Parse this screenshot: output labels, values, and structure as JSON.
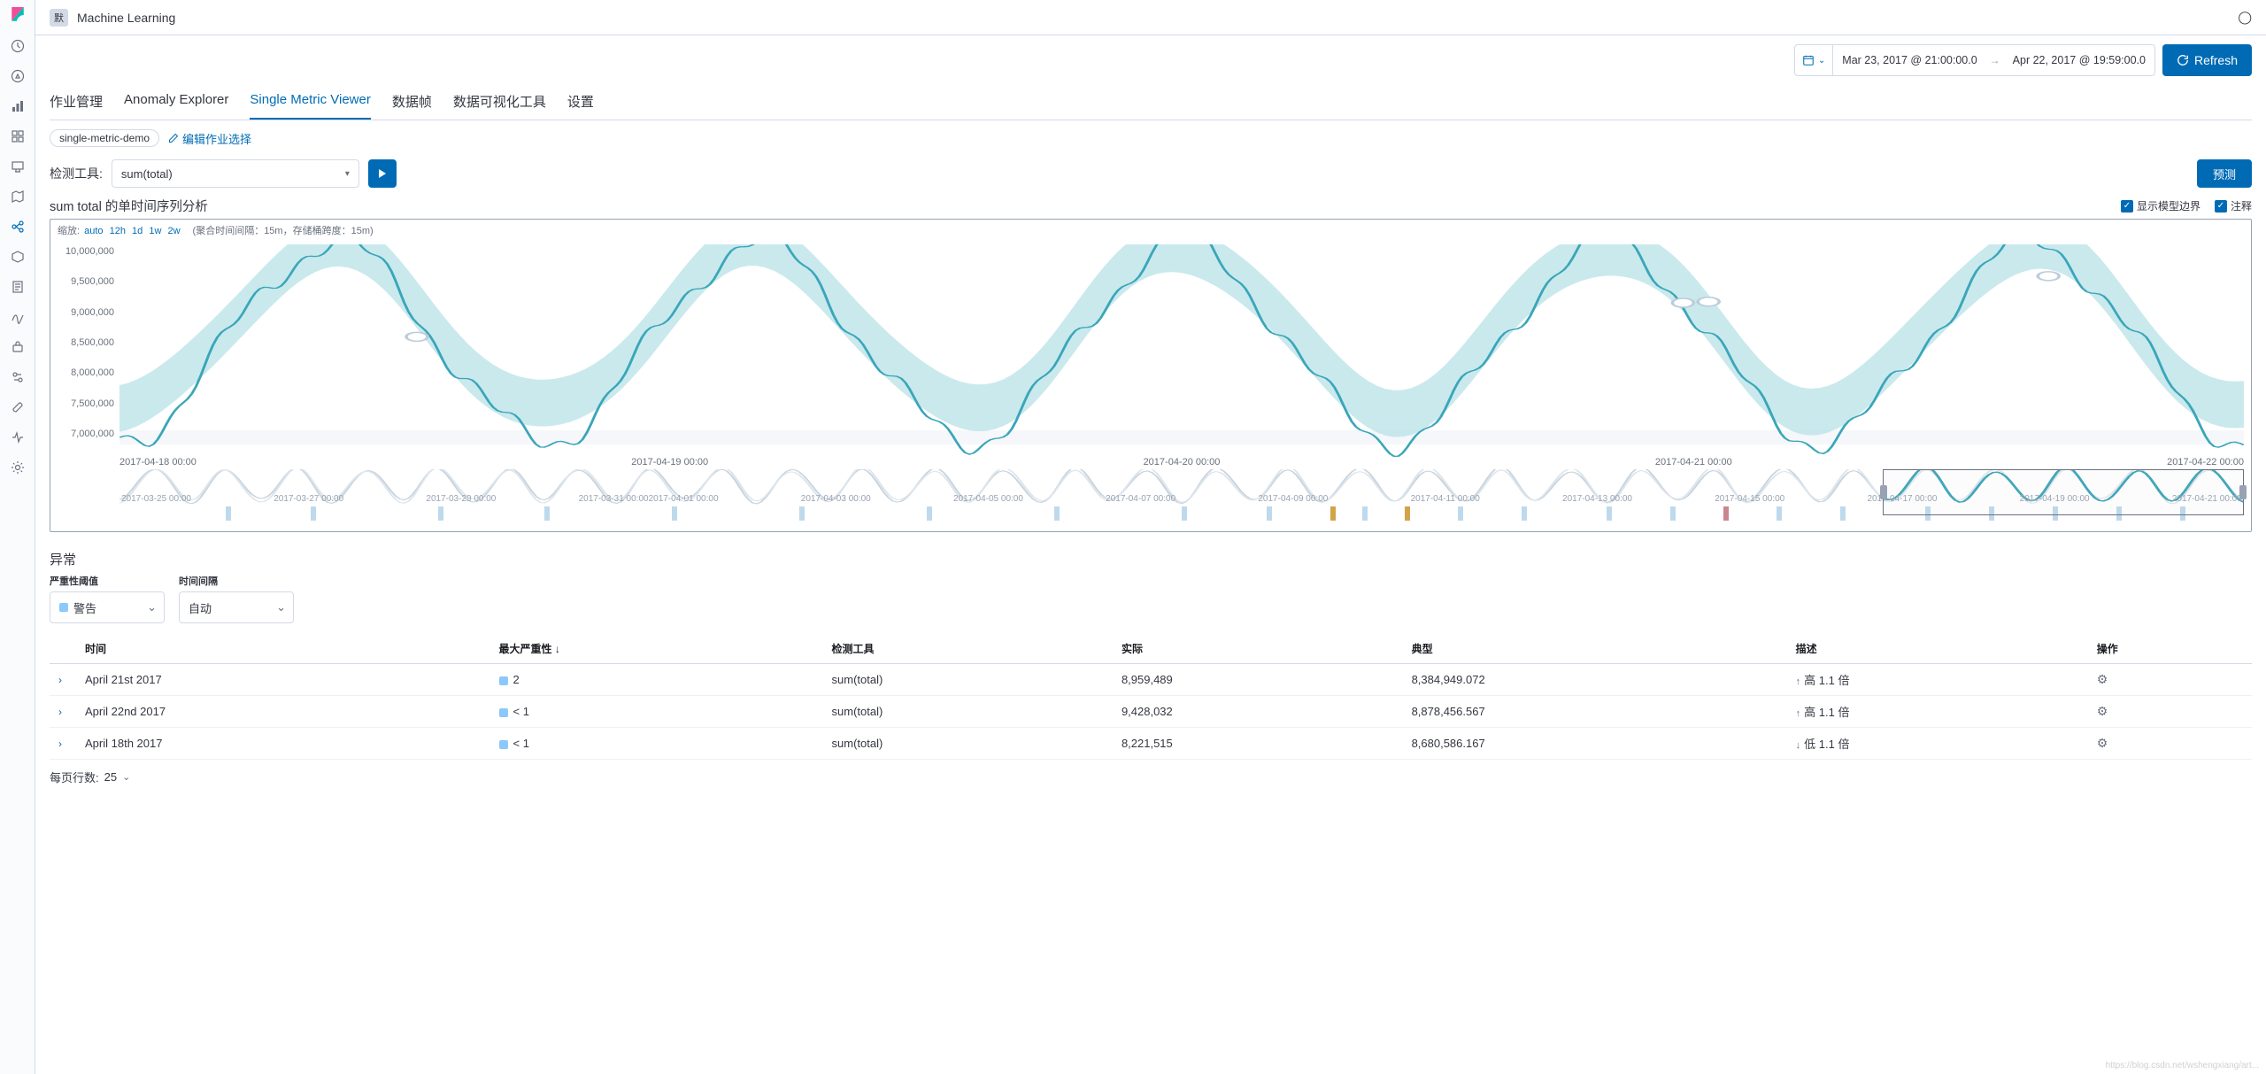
{
  "header": {
    "badge": "默",
    "app_title": "Machine Learning"
  },
  "datepicker": {
    "from": "Mar 23, 2017 @ 21:00:00.0",
    "to": "Apr 22, 2017 @ 19:59:00.0",
    "refresh": "Refresh"
  },
  "tabs": [
    "作业管理",
    "Anomaly Explorer",
    "Single Metric Viewer",
    "数据帧",
    "数据可视化工具",
    "设置"
  ],
  "active_tab": 2,
  "job": {
    "name": "single-metric-demo",
    "edit": "编辑作业选择"
  },
  "detector": {
    "label": "检测工具:",
    "value": "sum(total)",
    "forecast": "预测"
  },
  "chart": {
    "subtitle": "sum total 的单时间序列分析",
    "chk_bounds": "显示模型边界",
    "chk_annot": "注释",
    "zoom_label": "缩放:",
    "zoom_opts": [
      "auto",
      "12h",
      "1d",
      "1w",
      "2w"
    ],
    "bucket_info": "(聚合时间间隔：15m，存储桶跨度：15m)"
  },
  "chart_data": {
    "type": "line",
    "ylim": [
      6500000,
      10000000
    ],
    "yticks": [
      "10,000,000",
      "9,500,000",
      "9,000,000",
      "8,500,000",
      "8,000,000",
      "7,500,000",
      "7,000,000"
    ],
    "xticks": [
      "2017-04-18 00:00",
      "2017-04-19 00:00",
      "2017-04-20 00:00",
      "2017-04-21 00:00",
      "2017-04-22 00:00"
    ],
    "anomaly_points": [
      {
        "x_frac": 0.14,
        "val": 8340000
      },
      {
        "x_frac": 0.736,
        "val": 8950000
      },
      {
        "x_frac": 0.748,
        "val": 8970000
      },
      {
        "x_frac": 0.908,
        "val": 9430000
      }
    ],
    "overview_ticks": [
      "2017-03-25 00:00",
      "2017-03-27 00:00",
      "2017-03-29 00:00",
      "2017-03-31 00:002017-04-01 00:00",
      "2017-04-03 00:00",
      "2017-04-05 00:00",
      "2017-04-07 00:00",
      "2017-04-09 00:00",
      "2017-04-11 00:00",
      "2017-04-13 00:00",
      "2017-04-15 00:00",
      "2017-04-17 00:00",
      "2017-04-19 00:00",
      "2017-04-21 00:00"
    ],
    "overview_window": {
      "left_frac": 0.83,
      "width_frac": 0.17
    }
  },
  "anomalies": {
    "title": "异常",
    "severity_label": "严重性阈值",
    "severity_value": "警告",
    "interval_label": "时间间隔",
    "interval_value": "自动",
    "columns": [
      "时间",
      "最大严重性 ↓",
      "检测工具",
      "实际",
      "典型",
      "描述",
      "操作"
    ],
    "rows": [
      {
        "time": "April 21st 2017",
        "sev": "2",
        "det": "sum(total)",
        "actual": "8,959,489",
        "typical": "8,384,949.072",
        "desc_arrow": "↑",
        "desc": "高 1.1 倍"
      },
      {
        "time": "April 22nd 2017",
        "sev": "< 1",
        "det": "sum(total)",
        "actual": "9,428,032",
        "typical": "8,878,456.567",
        "desc_arrow": "↑",
        "desc": "高 1.1 倍"
      },
      {
        "time": "April 18th 2017",
        "sev": "< 1",
        "det": "sum(total)",
        "actual": "8,221,515",
        "typical": "8,680,586.167",
        "desc_arrow": "↓",
        "desc": "低 1.1 倍"
      }
    ],
    "pager_label": "每页行数:",
    "pager_size": "25"
  }
}
